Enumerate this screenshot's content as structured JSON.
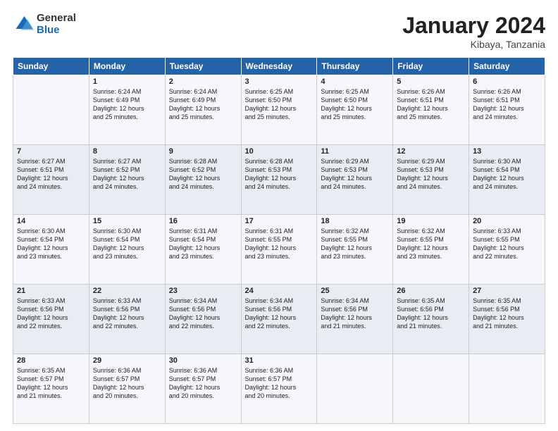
{
  "logo": {
    "general": "General",
    "blue": "Blue"
  },
  "header": {
    "month": "January 2024",
    "location": "Kibaya, Tanzania"
  },
  "columns": [
    "Sunday",
    "Monday",
    "Tuesday",
    "Wednesday",
    "Thursday",
    "Friday",
    "Saturday"
  ],
  "weeks": [
    [
      {
        "day": "",
        "info": ""
      },
      {
        "day": "1",
        "info": "Sunrise: 6:24 AM\nSunset: 6:49 PM\nDaylight: 12 hours\nand 25 minutes."
      },
      {
        "day": "2",
        "info": "Sunrise: 6:24 AM\nSunset: 6:49 PM\nDaylight: 12 hours\nand 25 minutes."
      },
      {
        "day": "3",
        "info": "Sunrise: 6:25 AM\nSunset: 6:50 PM\nDaylight: 12 hours\nand 25 minutes."
      },
      {
        "day": "4",
        "info": "Sunrise: 6:25 AM\nSunset: 6:50 PM\nDaylight: 12 hours\nand 25 minutes."
      },
      {
        "day": "5",
        "info": "Sunrise: 6:26 AM\nSunset: 6:51 PM\nDaylight: 12 hours\nand 25 minutes."
      },
      {
        "day": "6",
        "info": "Sunrise: 6:26 AM\nSunset: 6:51 PM\nDaylight: 12 hours\nand 24 minutes."
      }
    ],
    [
      {
        "day": "7",
        "info": "Sunrise: 6:27 AM\nSunset: 6:51 PM\nDaylight: 12 hours\nand 24 minutes."
      },
      {
        "day": "8",
        "info": "Sunrise: 6:27 AM\nSunset: 6:52 PM\nDaylight: 12 hours\nand 24 minutes."
      },
      {
        "day": "9",
        "info": "Sunrise: 6:28 AM\nSunset: 6:52 PM\nDaylight: 12 hours\nand 24 minutes."
      },
      {
        "day": "10",
        "info": "Sunrise: 6:28 AM\nSunset: 6:53 PM\nDaylight: 12 hours\nand 24 minutes."
      },
      {
        "day": "11",
        "info": "Sunrise: 6:29 AM\nSunset: 6:53 PM\nDaylight: 12 hours\nand 24 minutes."
      },
      {
        "day": "12",
        "info": "Sunrise: 6:29 AM\nSunset: 6:53 PM\nDaylight: 12 hours\nand 24 minutes."
      },
      {
        "day": "13",
        "info": "Sunrise: 6:30 AM\nSunset: 6:54 PM\nDaylight: 12 hours\nand 24 minutes."
      }
    ],
    [
      {
        "day": "14",
        "info": "Sunrise: 6:30 AM\nSunset: 6:54 PM\nDaylight: 12 hours\nand 23 minutes."
      },
      {
        "day": "15",
        "info": "Sunrise: 6:30 AM\nSunset: 6:54 PM\nDaylight: 12 hours\nand 23 minutes."
      },
      {
        "day": "16",
        "info": "Sunrise: 6:31 AM\nSunset: 6:54 PM\nDaylight: 12 hours\nand 23 minutes."
      },
      {
        "day": "17",
        "info": "Sunrise: 6:31 AM\nSunset: 6:55 PM\nDaylight: 12 hours\nand 23 minutes."
      },
      {
        "day": "18",
        "info": "Sunrise: 6:32 AM\nSunset: 6:55 PM\nDaylight: 12 hours\nand 23 minutes."
      },
      {
        "day": "19",
        "info": "Sunrise: 6:32 AM\nSunset: 6:55 PM\nDaylight: 12 hours\nand 23 minutes."
      },
      {
        "day": "20",
        "info": "Sunrise: 6:33 AM\nSunset: 6:55 PM\nDaylight: 12 hours\nand 22 minutes."
      }
    ],
    [
      {
        "day": "21",
        "info": "Sunrise: 6:33 AM\nSunset: 6:56 PM\nDaylight: 12 hours\nand 22 minutes."
      },
      {
        "day": "22",
        "info": "Sunrise: 6:33 AM\nSunset: 6:56 PM\nDaylight: 12 hours\nand 22 minutes."
      },
      {
        "day": "23",
        "info": "Sunrise: 6:34 AM\nSunset: 6:56 PM\nDaylight: 12 hours\nand 22 minutes."
      },
      {
        "day": "24",
        "info": "Sunrise: 6:34 AM\nSunset: 6:56 PM\nDaylight: 12 hours\nand 22 minutes."
      },
      {
        "day": "25",
        "info": "Sunrise: 6:34 AM\nSunset: 6:56 PM\nDaylight: 12 hours\nand 21 minutes."
      },
      {
        "day": "26",
        "info": "Sunrise: 6:35 AM\nSunset: 6:56 PM\nDaylight: 12 hours\nand 21 minutes."
      },
      {
        "day": "27",
        "info": "Sunrise: 6:35 AM\nSunset: 6:56 PM\nDaylight: 12 hours\nand 21 minutes."
      }
    ],
    [
      {
        "day": "28",
        "info": "Sunrise: 6:35 AM\nSunset: 6:57 PM\nDaylight: 12 hours\nand 21 minutes."
      },
      {
        "day": "29",
        "info": "Sunrise: 6:36 AM\nSunset: 6:57 PM\nDaylight: 12 hours\nand 20 minutes."
      },
      {
        "day": "30",
        "info": "Sunrise: 6:36 AM\nSunset: 6:57 PM\nDaylight: 12 hours\nand 20 minutes."
      },
      {
        "day": "31",
        "info": "Sunrise: 6:36 AM\nSunset: 6:57 PM\nDaylight: 12 hours\nand 20 minutes."
      },
      {
        "day": "",
        "info": ""
      },
      {
        "day": "",
        "info": ""
      },
      {
        "day": "",
        "info": ""
      }
    ]
  ]
}
